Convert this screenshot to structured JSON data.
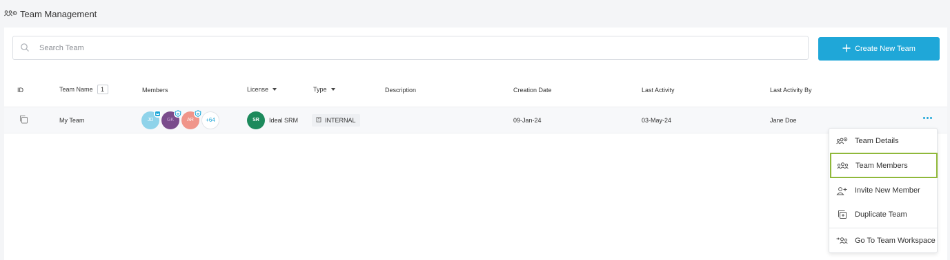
{
  "header": {
    "title": "Team Management",
    "icon": "team-management-icon"
  },
  "search": {
    "placeholder": "Search Team",
    "value": ""
  },
  "create_button": {
    "label": "Create New Team",
    "icon": "plus-icon"
  },
  "table": {
    "columns": {
      "id": "ID",
      "team_name": "Team Name",
      "team_count": "1",
      "members": "Members",
      "license": "License",
      "type": "Type",
      "description": "Description",
      "creation_date": "Creation Date",
      "last_activity": "Last Activity",
      "last_activity_by": "Last Activity By"
    },
    "rows": [
      {
        "team_name": "My Team",
        "members": {
          "avatars": [
            {
              "initials": "JD",
              "color": "#8fd3ea",
              "badge": "crown"
            },
            {
              "initials": "GK",
              "color": "#7a4c8c",
              "badge": "shield"
            },
            {
              "initials": "AR",
              "color": "#f0958a",
              "badge": "shield"
            }
          ],
          "more": "+64"
        },
        "license": {
          "logo": "SR",
          "name": "Ideal SRM"
        },
        "type": "INTERNAL",
        "description": "",
        "creation_date": "09-Jan-24",
        "last_activity": "03-May-24",
        "last_activity_by": "Jane Doe"
      }
    ]
  },
  "row_menu": {
    "items": [
      {
        "label": "Team Details",
        "icon": "team-settings-icon"
      },
      {
        "label": "Team Members",
        "icon": "team-members-icon",
        "highlighted": true
      },
      {
        "label": "Invite New Member",
        "icon": "add-user-icon"
      },
      {
        "label": "Duplicate Team",
        "icon": "duplicate-icon"
      },
      {
        "label": "Go To Team Workspace",
        "icon": "team-workspace-icon"
      }
    ]
  },
  "colors": {
    "accent": "#1fa7d8",
    "highlight": "#8fb83a",
    "license_logo": "#1d8a5c"
  }
}
